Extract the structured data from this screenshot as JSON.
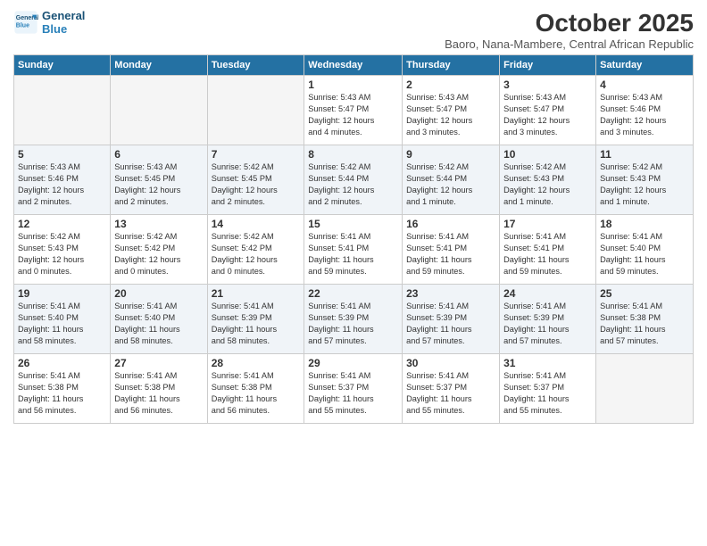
{
  "logo": {
    "line1": "General",
    "line2": "Blue"
  },
  "title": "October 2025",
  "subtitle": "Baoro, Nana-Mambere, Central African Republic",
  "weekdays": [
    "Sunday",
    "Monday",
    "Tuesday",
    "Wednesday",
    "Thursday",
    "Friday",
    "Saturday"
  ],
  "weeks": [
    [
      {
        "day": "",
        "info": ""
      },
      {
        "day": "",
        "info": ""
      },
      {
        "day": "",
        "info": ""
      },
      {
        "day": "1",
        "info": "Sunrise: 5:43 AM\nSunset: 5:47 PM\nDaylight: 12 hours\nand 4 minutes."
      },
      {
        "day": "2",
        "info": "Sunrise: 5:43 AM\nSunset: 5:47 PM\nDaylight: 12 hours\nand 3 minutes."
      },
      {
        "day": "3",
        "info": "Sunrise: 5:43 AM\nSunset: 5:47 PM\nDaylight: 12 hours\nand 3 minutes."
      },
      {
        "day": "4",
        "info": "Sunrise: 5:43 AM\nSunset: 5:46 PM\nDaylight: 12 hours\nand 3 minutes."
      }
    ],
    [
      {
        "day": "5",
        "info": "Sunrise: 5:43 AM\nSunset: 5:46 PM\nDaylight: 12 hours\nand 2 minutes."
      },
      {
        "day": "6",
        "info": "Sunrise: 5:43 AM\nSunset: 5:45 PM\nDaylight: 12 hours\nand 2 minutes."
      },
      {
        "day": "7",
        "info": "Sunrise: 5:42 AM\nSunset: 5:45 PM\nDaylight: 12 hours\nand 2 minutes."
      },
      {
        "day": "8",
        "info": "Sunrise: 5:42 AM\nSunset: 5:44 PM\nDaylight: 12 hours\nand 2 minutes."
      },
      {
        "day": "9",
        "info": "Sunrise: 5:42 AM\nSunset: 5:44 PM\nDaylight: 12 hours\nand 1 minute."
      },
      {
        "day": "10",
        "info": "Sunrise: 5:42 AM\nSunset: 5:43 PM\nDaylight: 12 hours\nand 1 minute."
      },
      {
        "day": "11",
        "info": "Sunrise: 5:42 AM\nSunset: 5:43 PM\nDaylight: 12 hours\nand 1 minute."
      }
    ],
    [
      {
        "day": "12",
        "info": "Sunrise: 5:42 AM\nSunset: 5:43 PM\nDaylight: 12 hours\nand 0 minutes."
      },
      {
        "day": "13",
        "info": "Sunrise: 5:42 AM\nSunset: 5:42 PM\nDaylight: 12 hours\nand 0 minutes."
      },
      {
        "day": "14",
        "info": "Sunrise: 5:42 AM\nSunset: 5:42 PM\nDaylight: 12 hours\nand 0 minutes."
      },
      {
        "day": "15",
        "info": "Sunrise: 5:41 AM\nSunset: 5:41 PM\nDaylight: 11 hours\nand 59 minutes."
      },
      {
        "day": "16",
        "info": "Sunrise: 5:41 AM\nSunset: 5:41 PM\nDaylight: 11 hours\nand 59 minutes."
      },
      {
        "day": "17",
        "info": "Sunrise: 5:41 AM\nSunset: 5:41 PM\nDaylight: 11 hours\nand 59 minutes."
      },
      {
        "day": "18",
        "info": "Sunrise: 5:41 AM\nSunset: 5:40 PM\nDaylight: 11 hours\nand 59 minutes."
      }
    ],
    [
      {
        "day": "19",
        "info": "Sunrise: 5:41 AM\nSunset: 5:40 PM\nDaylight: 11 hours\nand 58 minutes."
      },
      {
        "day": "20",
        "info": "Sunrise: 5:41 AM\nSunset: 5:40 PM\nDaylight: 11 hours\nand 58 minutes."
      },
      {
        "day": "21",
        "info": "Sunrise: 5:41 AM\nSunset: 5:39 PM\nDaylight: 11 hours\nand 58 minutes."
      },
      {
        "day": "22",
        "info": "Sunrise: 5:41 AM\nSunset: 5:39 PM\nDaylight: 11 hours\nand 57 minutes."
      },
      {
        "day": "23",
        "info": "Sunrise: 5:41 AM\nSunset: 5:39 PM\nDaylight: 11 hours\nand 57 minutes."
      },
      {
        "day": "24",
        "info": "Sunrise: 5:41 AM\nSunset: 5:39 PM\nDaylight: 11 hours\nand 57 minutes."
      },
      {
        "day": "25",
        "info": "Sunrise: 5:41 AM\nSunset: 5:38 PM\nDaylight: 11 hours\nand 57 minutes."
      }
    ],
    [
      {
        "day": "26",
        "info": "Sunrise: 5:41 AM\nSunset: 5:38 PM\nDaylight: 11 hours\nand 56 minutes."
      },
      {
        "day": "27",
        "info": "Sunrise: 5:41 AM\nSunset: 5:38 PM\nDaylight: 11 hours\nand 56 minutes."
      },
      {
        "day": "28",
        "info": "Sunrise: 5:41 AM\nSunset: 5:38 PM\nDaylight: 11 hours\nand 56 minutes."
      },
      {
        "day": "29",
        "info": "Sunrise: 5:41 AM\nSunset: 5:37 PM\nDaylight: 11 hours\nand 55 minutes."
      },
      {
        "day": "30",
        "info": "Sunrise: 5:41 AM\nSunset: 5:37 PM\nDaylight: 11 hours\nand 55 minutes."
      },
      {
        "day": "31",
        "info": "Sunrise: 5:41 AM\nSunset: 5:37 PM\nDaylight: 11 hours\nand 55 minutes."
      },
      {
        "day": "",
        "info": ""
      }
    ]
  ]
}
